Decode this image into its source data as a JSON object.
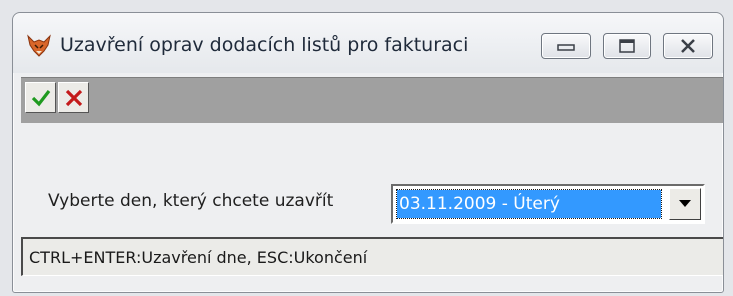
{
  "window": {
    "title": "Uzavření oprav dodacích listů pro fakturaci",
    "icon": "fox-icon",
    "caption_buttons": [
      "minimize-icon",
      "maximize-icon",
      "close-icon"
    ]
  },
  "toolbar": {
    "buttons": [
      {
        "icon": "checkmark-icon",
        "color": "#1f9a1f"
      },
      {
        "icon": "x-icon",
        "color": "#c41a1a"
      }
    ]
  },
  "form": {
    "day_label": "Vyberte den, který chcete uzavřít",
    "day_selected": "03.11.2009 - Úterý"
  },
  "status": {
    "text": "CTRL+ENTER:Uzavření dne, ESC:Ukončení"
  },
  "colors": {
    "selection": "#3399ff",
    "toolbar_bg": "#a0a0a0"
  }
}
